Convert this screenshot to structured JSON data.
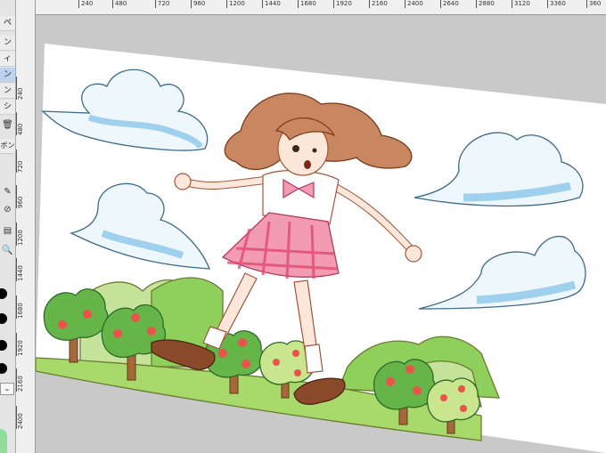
{
  "app": {
    "name": "illustration-editor"
  },
  "toolbar": {
    "labels": [
      "ン",
      "ィ",
      "ン",
      "ン",
      "シ"
    ],
    "top_label": "ペ",
    "icons": [
      "trash-icon",
      "pen-icon",
      "blend-icon",
      "fill-icon",
      "search-icon",
      "chevron-down-icon"
    ],
    "mid_label": "ボン"
  },
  "ruler": {
    "horizontal": [
      "240",
      "480",
      "720",
      "960",
      "1200",
      "1440",
      "1680",
      "1920",
      "2160",
      "2400",
      "2640",
      "2880",
      "3120",
      "3360",
      "360"
    ],
    "vertical": [
      "240",
      "480",
      "720",
      "960",
      "1200",
      "1440",
      "1680",
      "1920",
      "2160",
      "2400"
    ]
  },
  "canvas": {
    "description_colors": {
      "sky_white": "#ffffff",
      "cloud": "#a9d8f2",
      "hair": "#b06b45",
      "skirt": "#e0577a",
      "grass": "#8ccc5a",
      "hill": "#c8e49a"
    }
  }
}
